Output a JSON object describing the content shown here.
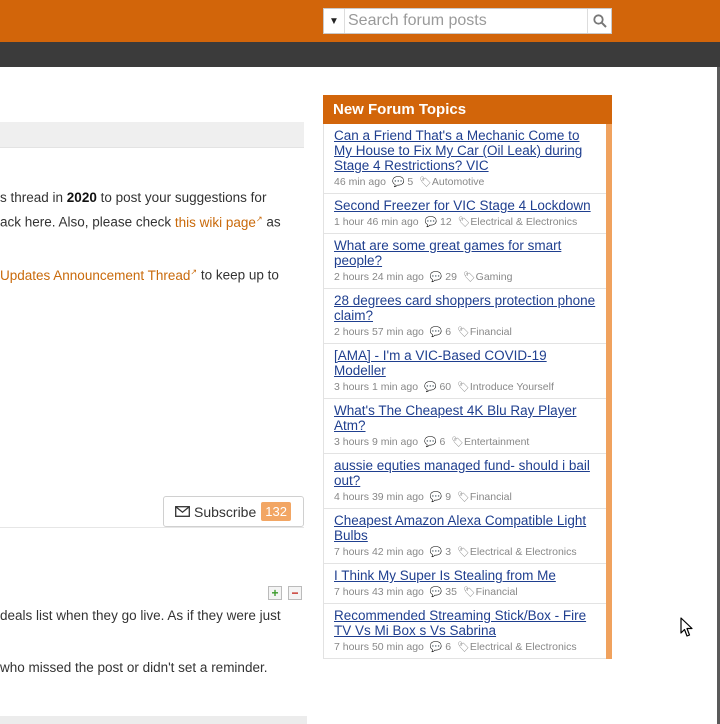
{
  "search": {
    "placeholder": "Search forum posts"
  },
  "main": {
    "line1_pre": "s thread in ",
    "line1_bold": "2020",
    "line1_post": " to post your suggestions for",
    "line2_pre": "ack here. Also, please check ",
    "line2_link": "this wiki page",
    "line2_post": " as",
    "line3_link": "Updates Announcement Thread",
    "line3_post": " to keep up to",
    "subscribe_label": "Subscribe",
    "subscribe_count": "132",
    "post_line1": "deals list when they go live. As if they were just",
    "post_line2": "who missed the post or didn't set a reminder."
  },
  "sidebar": {
    "title": "New Forum Topics",
    "topics": [
      {
        "title": "Can a Friend That's a Mechanic Come to My House to Fix My Car (Oil Leak) during Stage 4 Restrictions? VIC",
        "time": "46 min ago",
        "comments": "5",
        "category": "Automotive"
      },
      {
        "title": "Second Freezer for VIC Stage 4 Lockdown",
        "time": "1 hour 46 min ago",
        "comments": "12",
        "category": "Electrical & Electronics"
      },
      {
        "title": "What are some great games for smart people?",
        "time": "2 hours 24 min ago",
        "comments": "29",
        "category": "Gaming"
      },
      {
        "title": "28 degrees card shoppers protection phone claim?",
        "time": "2 hours 57 min ago",
        "comments": "6",
        "category": "Financial"
      },
      {
        "title": "[AMA] - I'm a VIC-Based COVID-19 Modeller",
        "time": "3 hours 1 min ago",
        "comments": "60",
        "category": "Introduce Yourself"
      },
      {
        "title": "What's The Cheapest 4K Blu Ray Player Atm?",
        "time": "3 hours 9 min ago",
        "comments": "6",
        "category": "Entertainment"
      },
      {
        "title": "aussie equties managed fund- should i bail out?",
        "time": "4 hours 39 min ago",
        "comments": "9",
        "category": "Financial"
      },
      {
        "title": "Cheapest Amazon Alexa Compatible Light Bulbs",
        "time": "7 hours 42 min ago",
        "comments": "3",
        "category": "Electrical & Electronics"
      },
      {
        "title": "I Think My Super Is Stealing from Me",
        "time": "7 hours 43 min ago",
        "comments": "35",
        "category": "Financial"
      },
      {
        "title": "Recommended Streaming Stick/Box - Fire TV Vs Mi Box s Vs Sabrina",
        "time": "7 hours 50 min ago",
        "comments": "6",
        "category": "Electrical & Electronics"
      }
    ]
  }
}
